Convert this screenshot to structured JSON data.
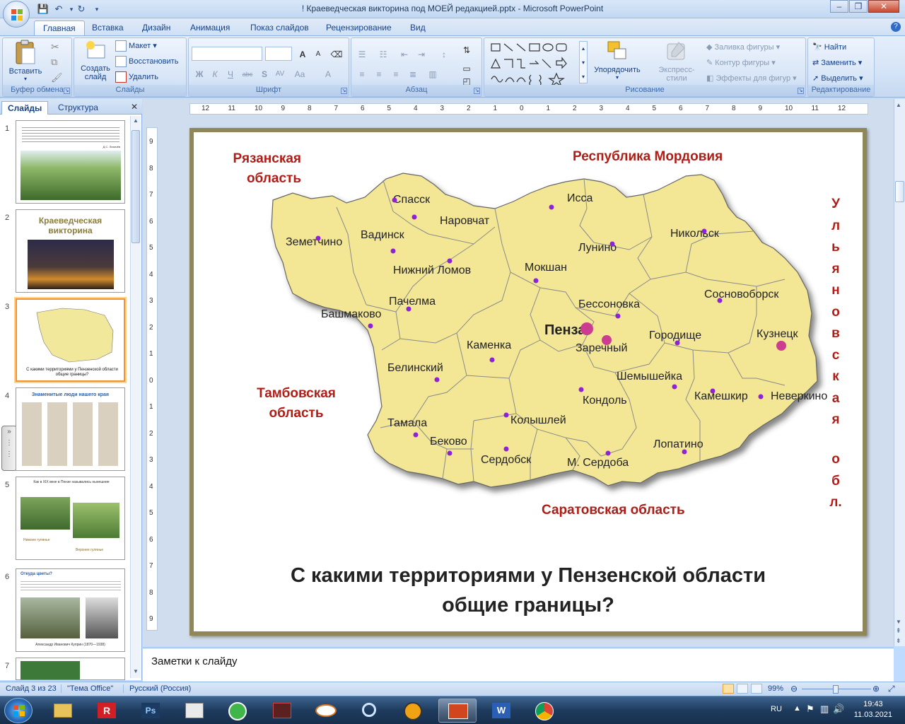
{
  "window": {
    "title": "! Краеведческая викторина под МОЕЙ редакцией.pptx - Microsoft PowerPoint",
    "controls": {
      "minimize": "–",
      "restore": "❐",
      "close": "✕"
    }
  },
  "tabs": [
    "Главная",
    "Вставка",
    "Дизайн",
    "Анимация",
    "Показ слайдов",
    "Рецензирование",
    "Вид"
  ],
  "help_icon": "?",
  "ribbon": {
    "clipboard": {
      "label": "Буфер обмена",
      "paste": "Вставить"
    },
    "slides": {
      "label": "Слайды",
      "new_slide": "Создать слайд",
      "layout": "Макет",
      "reset": "Восстановить",
      "delete": "Удалить"
    },
    "font": {
      "label": "Шрифт",
      "buttons": [
        "Ж",
        "К",
        "Ч",
        "abc",
        "S",
        "AV",
        "Aa",
        "A"
      ],
      "grow": "A",
      "shrink": "A"
    },
    "paragraph": {
      "label": "Абзац"
    },
    "drawing": {
      "label": "Рисование",
      "arrange": "Упорядочить",
      "quick_styles": "Экспресс-стили",
      "fill": "Заливка фигуры",
      "outline": "Контур фигуры",
      "effects": "Эффекты для фигур"
    },
    "editing": {
      "label": "Редактирование",
      "find": "Найти",
      "replace": "Заменить",
      "select": "Выделить"
    }
  },
  "pane": {
    "tab_slides": "Слайды",
    "tab_outline": "Структура",
    "close": "✕"
  },
  "thumbnails": [
    {
      "num": "1",
      "caption": "Д.С. Лихачёв"
    },
    {
      "num": "2",
      "title": "Краеведческая викторина"
    },
    {
      "num": "3",
      "caption": "С какими территориями у Пензенской области общие границы?"
    },
    {
      "num": "4",
      "title": "Знаменитые люди нашего края"
    },
    {
      "num": "5",
      "title": "Как в XIX веке в Пензе назывались нынешние",
      "left_caption": "Нижнее гулянье",
      "right_caption": "Верхнее гулянье"
    },
    {
      "num": "6",
      "title": "Откуда цветы?",
      "caption": "Александр Иванович Куприн (1870—1938)"
    },
    {
      "num": "7"
    }
  ],
  "ruler": {
    "h_ticks": [
      "12",
      "11",
      "10",
      "9",
      "8",
      "7",
      "6",
      "5",
      "4",
      "3",
      "2",
      "1",
      "0",
      "1",
      "2",
      "3",
      "4",
      "5",
      "6",
      "7",
      "8",
      "9",
      "10",
      "11",
      "12"
    ],
    "v_ticks": [
      "9",
      "8",
      "7",
      "6",
      "5",
      "4",
      "3",
      "2",
      "1",
      "0",
      "1",
      "2",
      "3",
      "4",
      "5",
      "6",
      "7",
      "8",
      "9"
    ]
  },
  "slide": {
    "neighbors": {
      "ryazan": [
        "Рязанская",
        "область"
      ],
      "mordovia": "Республика Мордовия",
      "ulyanovsk": [
        "У",
        "л",
        "ь",
        "я",
        "н",
        "о",
        "в",
        "с",
        "к",
        "а",
        "я",
        "о",
        "б",
        "л."
      ],
      "tambov": [
        "Тамбовская",
        "область"
      ],
      "saratov": "Саратовская область"
    },
    "districts": [
      "Спасск",
      "Наровчат",
      "Исса",
      "Земетчино",
      "Вадинск",
      "Лунино",
      "Никольск",
      "Нижний Ломов",
      "Мокшан",
      "Сосновоборск",
      "Пачелма",
      "Бессоновка",
      "Башмаково",
      "Пенза",
      "Кузнецк",
      "Городище",
      "Заречный",
      "Каменка",
      "Белинский",
      "Шемышейка",
      "Неверкино",
      "Камешкир",
      "Кондоль",
      "Колышлей",
      "Тамала",
      "Беково",
      "Лопатино",
      "Сердобск",
      "М. Сердоба"
    ],
    "question": [
      "С какими территориями у Пензенской области",
      "общие границы?"
    ]
  },
  "notes_placeholder": "Заметки к слайду",
  "status": {
    "slide": "Слайд 3 из 23",
    "theme": "\"Тема Office\"",
    "language": "Русский (Россия)",
    "zoom": "99%"
  },
  "taskbar": {
    "lang": "RU",
    "time": "19:43",
    "date": "11.03.2021"
  }
}
